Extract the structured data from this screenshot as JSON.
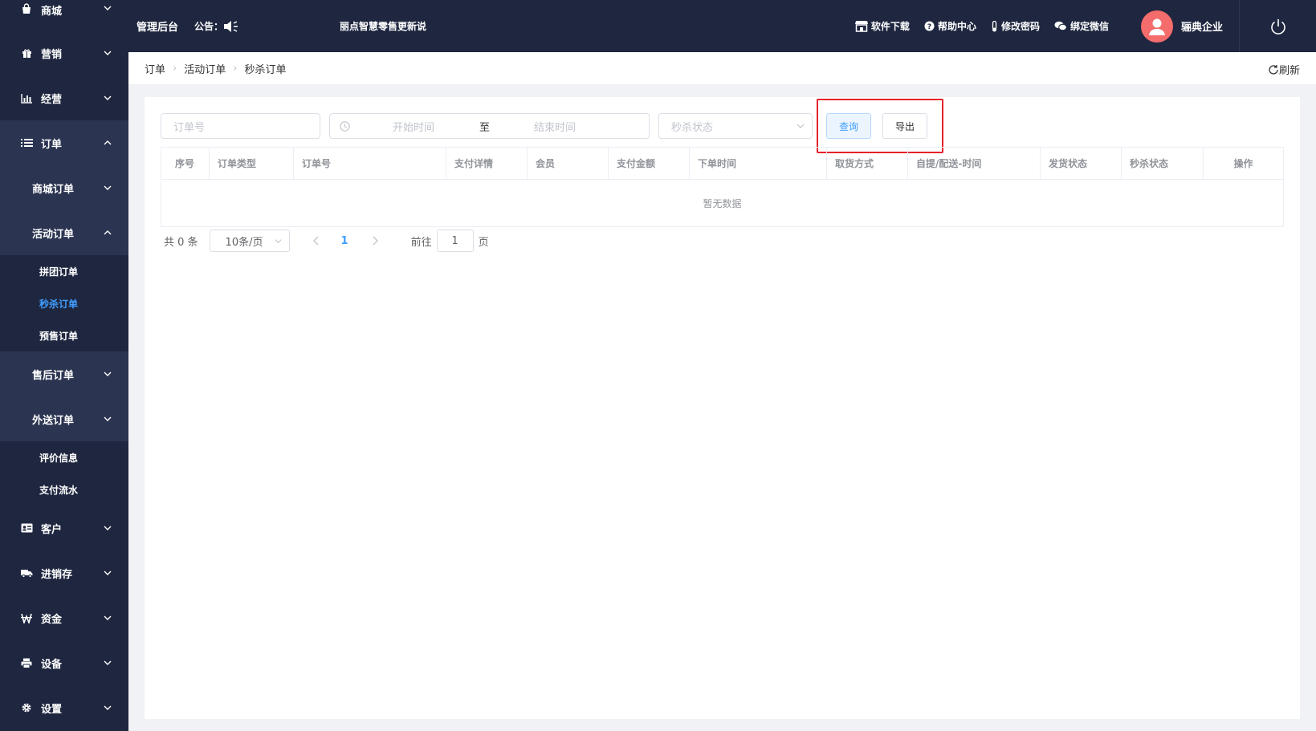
{
  "sidebar": {
    "items": [
      {
        "label": "商城",
        "icon": "bag-icon"
      },
      {
        "label": "营销",
        "icon": "gift-icon"
      },
      {
        "label": "经营",
        "icon": "bar-chart-icon"
      },
      {
        "label": "订单",
        "icon": "list-icon"
      },
      {
        "label": "客户",
        "icon": "id-card-icon"
      },
      {
        "label": "进销存",
        "icon": "truck-icon"
      },
      {
        "label": "资金",
        "icon": "won-icon"
      },
      {
        "label": "设备",
        "icon": "printer-icon"
      },
      {
        "label": "设置",
        "icon": "gear-icon"
      }
    ],
    "order_sub": {
      "mall_orders": "商城订单",
      "activity_orders": "活动订单",
      "activity_leaves": [
        "拼团订单",
        "秒杀订单",
        "预售订单"
      ],
      "after_sale": "售后订单",
      "delivery": "外送订单",
      "leaves": [
        "评价信息",
        "支付流水"
      ]
    }
  },
  "topbar": {
    "title": "管理后台",
    "notice_label": "公告：",
    "notice_text": "丽点智慧零售更新说",
    "links": [
      "软件下载",
      "帮助中心",
      "修改密码",
      "绑定微信"
    ],
    "company": "骊典企业"
  },
  "breadcrumb": {
    "items": [
      "订单",
      "活动订单",
      "秒杀订单"
    ],
    "refresh": "刷新"
  },
  "filters": {
    "order_no_placeholder": "订单号",
    "start_placeholder": "开始时间",
    "range_sep": "至",
    "end_placeholder": "结束时间",
    "status_placeholder": "秒杀状态",
    "query_label": "查询",
    "export_label": "导出"
  },
  "table": {
    "columns": [
      "序号",
      "订单类型",
      "订单号",
      "支付详情",
      "会员",
      "支付金额",
      "下单时间",
      "取货方式",
      "自提/配送-时间",
      "发货状态",
      "秒杀状态",
      "操作"
    ],
    "empty_text": "暂无数据"
  },
  "pager": {
    "total": "共 0 条",
    "page_size": "10条/页",
    "current_page": "1",
    "goto_label": "前往",
    "goto_value": "1",
    "page_suffix": "页"
  },
  "colors": {
    "sidebar_bg": "#1f2740",
    "accent": "#409eff",
    "highlight": "#e6212a"
  }
}
